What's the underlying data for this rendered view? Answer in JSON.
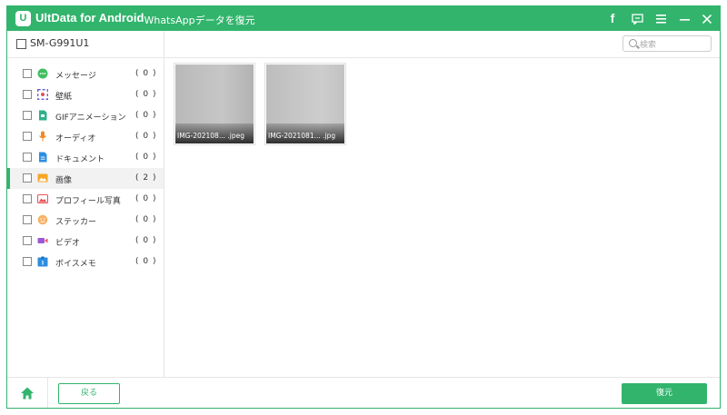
{
  "app": {
    "name": "UltData for Android",
    "subtitle": "- WhatsAppデータを復元",
    "logo_letter": "U",
    "accent": "#32b46c"
  },
  "titlebar_icons": [
    {
      "name": "facebook-icon",
      "glyph": "f"
    },
    {
      "name": "feedback-icon",
      "glyph": ""
    },
    {
      "name": "menu-icon",
      "glyph": "≡"
    },
    {
      "name": "minimize-icon",
      "glyph": "–"
    },
    {
      "name": "close-icon",
      "glyph": "✕"
    }
  ],
  "device": {
    "name": "SM-G991U1"
  },
  "search": {
    "placeholder": "検索"
  },
  "categories": [
    {
      "label": "メッセージ",
      "count": "( 0 )",
      "icon": "message-icon"
    },
    {
      "label": "壁紙",
      "count": "( 0 )",
      "icon": "wallpaper-icon"
    },
    {
      "label": "GIFアニメーション",
      "count": "( 0 )",
      "icon": "gif-icon"
    },
    {
      "label": "オーディオ",
      "count": "( 0 )",
      "icon": "audio-icon"
    },
    {
      "label": "ドキュメント",
      "count": "( 0 )",
      "icon": "document-icon"
    },
    {
      "label": "画像",
      "count": "( 2 )",
      "icon": "image-icon",
      "selected": true
    },
    {
      "label": "プロフィール写真",
      "count": "( 0 )",
      "icon": "profile-photo-icon"
    },
    {
      "label": "ステッカー",
      "count": "( 0 )",
      "icon": "sticker-icon"
    },
    {
      "label": "ビデオ",
      "count": "( 0 )",
      "icon": "video-icon"
    },
    {
      "label": "ボイスメモ",
      "count": "( 0 )",
      "icon": "voice-memo-icon"
    }
  ],
  "images": [
    {
      "filename": "IMG-202108... .jpeg"
    },
    {
      "filename": "IMG-2021081... .jpg"
    }
  ],
  "buttons": {
    "back": "戻る",
    "restore": "復元"
  }
}
